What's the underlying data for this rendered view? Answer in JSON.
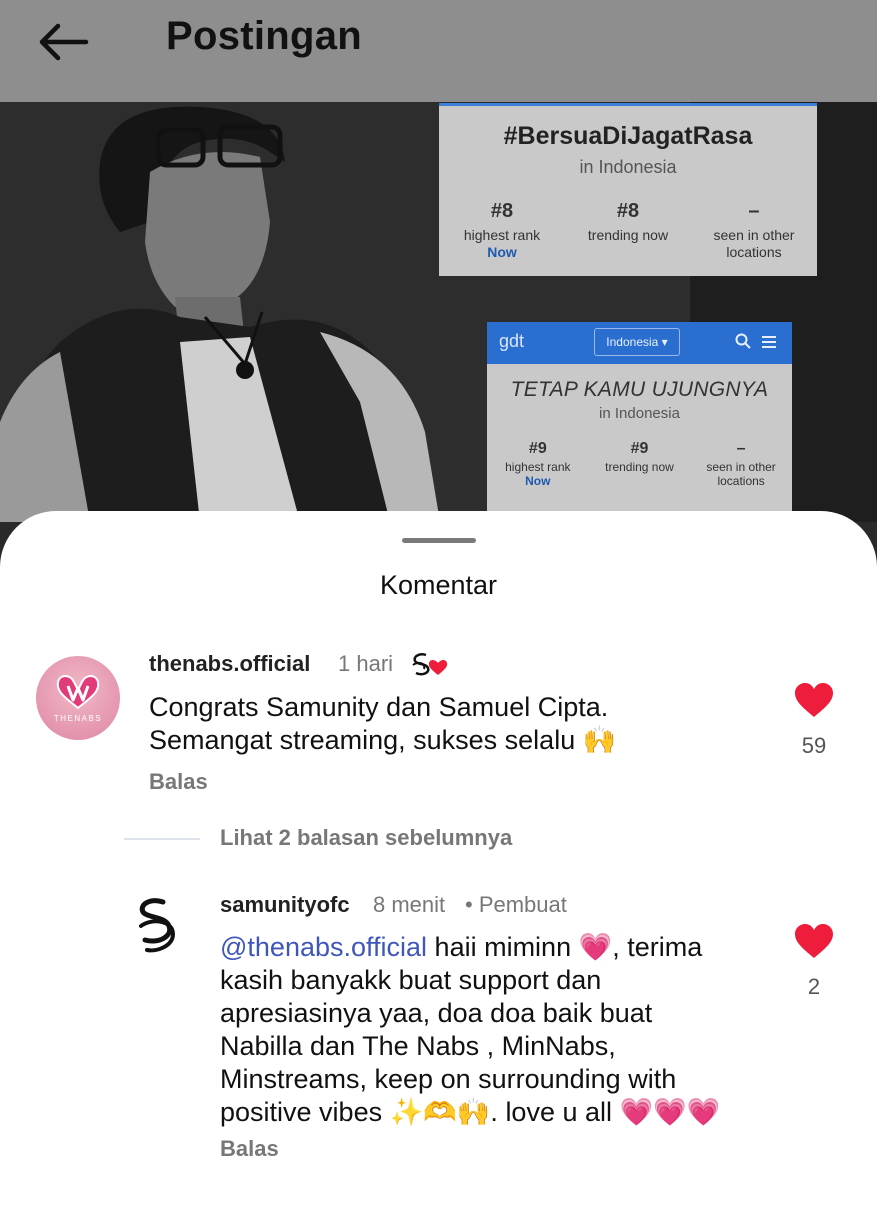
{
  "header": {
    "title": "Postingan",
    "back_icon": "arrow-left-icon"
  },
  "post": {
    "card1": {
      "title": "#BersuaDiJagatRasa",
      "subtitle": "in Indonesia",
      "stats": [
        {
          "value": "#8",
          "label": "highest rank",
          "note": "Now"
        },
        {
          "value": "#8",
          "label": "trending now",
          "note": ""
        },
        {
          "value": "–",
          "label": "seen in other locations",
          "note": ""
        }
      ]
    },
    "card2": {
      "brand": "gdt",
      "country_select": "Indonesia ▾",
      "title": "TETAP KAMU UJUNGNYA",
      "subtitle": "in Indonesia",
      "stats": [
        {
          "value": "#9",
          "label": "highest rank",
          "note": "Now"
        },
        {
          "value": "#9",
          "label": "trending now",
          "note": ""
        },
        {
          "value": "–",
          "label": "seen in other locations",
          "note": ""
        }
      ]
    }
  },
  "comments": {
    "title": "Komentar",
    "items": [
      {
        "username": "thenabs.official",
        "time": "1 hari",
        "avatar_text": "THENABS",
        "text_line1": "Congrats Samunity dan Samuel Cipta.",
        "text_line2": "Semangat streaming, sukses selalu 🙌",
        "reply": "Balas",
        "likes": "59"
      },
      {
        "username": "samunityofc",
        "time": "8 menit",
        "badge": "• Pembuat",
        "mention": "@thenabs.official",
        "text_line1": " haii miminn 💗, terima",
        "text_line2": "kasih banyakk buat support dan",
        "text_line3": "apresiasinya yaa, doa doa baik buat",
        "text_line4": "Nabilla dan The Nabs , MinNabs,",
        "text_line5": "Minstreams, keep on surrounding with",
        "text_line6": "positive vibes ✨🫶🙌. love u all 💗💗💗",
        "reply": "Balas",
        "likes": "2"
      }
    ],
    "view_more": "Lihat 2 balasan sebelumnya"
  },
  "colors": {
    "like": "#ee1d3c",
    "mention": "#3f57b9",
    "header_bg": "#8e8e8e"
  }
}
